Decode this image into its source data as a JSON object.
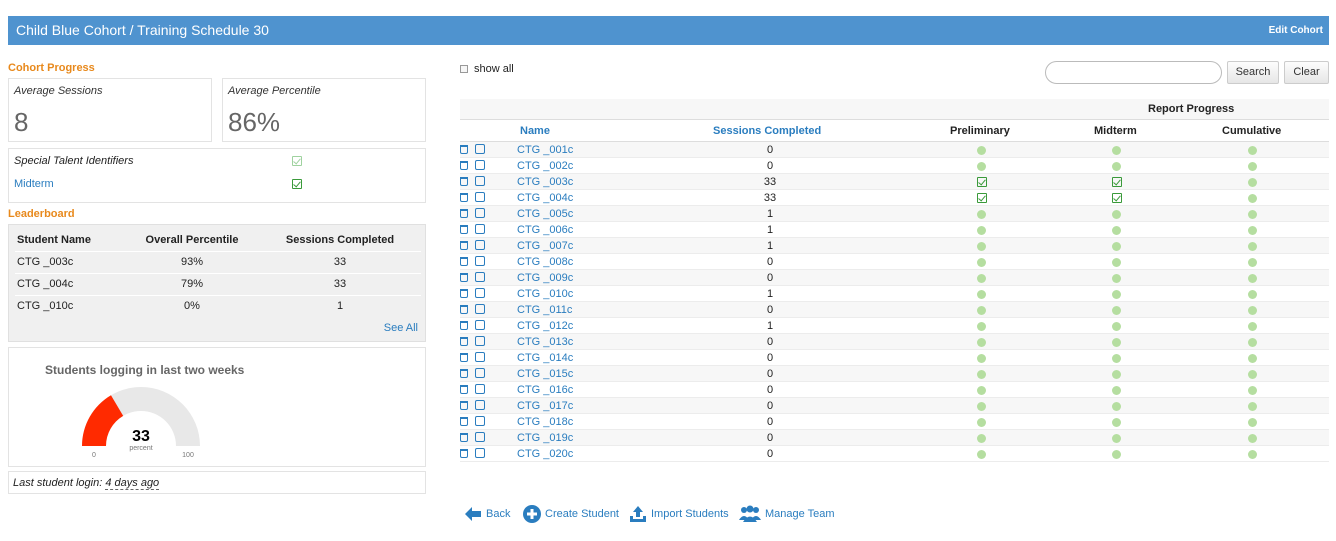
{
  "header": {
    "title": "Child Blue Cohort / Training Schedule 30",
    "edit_label": "Edit Cohort"
  },
  "cohort_progress": {
    "title": "Cohort Progress",
    "avg_sessions_label": "Average Sessions",
    "avg_sessions_value": "8",
    "avg_percentile_label": "Average Percentile",
    "avg_percentile_value": "86%"
  },
  "talent": {
    "label": "Special Talent Identifiers",
    "midterm_label": "Midterm"
  },
  "leaderboard": {
    "title": "Leaderboard",
    "headers": [
      "Student Name",
      "Overall Percentile",
      "Sessions Completed"
    ],
    "rows": [
      [
        "CTG _003c",
        "93%",
        "33"
      ],
      [
        "CTG _004c",
        "79%",
        "33"
      ],
      [
        "CTG _010c",
        "0%",
        "1"
      ]
    ],
    "see_all": "See All"
  },
  "gauge": {
    "title": "Students logging in last two weeks",
    "value": "33",
    "value_fraction": 0.33,
    "unit": "percent",
    "min": "0",
    "max": "100",
    "fill_color": "#ff2a00",
    "track_color": "#e8e8e8"
  },
  "last_login": {
    "label": "Last student login:",
    "value": "4 days ago"
  },
  "controls": {
    "show_all": "show all",
    "search_placeholder": "",
    "search_label": "Search",
    "clear_label": "Clear"
  },
  "students_table": {
    "report_progress": "Report Progress",
    "headers": {
      "name": "Name",
      "sessions": "Sessions Completed",
      "preliminary": "Preliminary",
      "midterm": "Midterm",
      "cumulative": "Cumulative"
    },
    "rows": [
      {
        "name": "CTG _001c",
        "sessions": "0",
        "prelim": "dot",
        "mid": "dot",
        "cum": "dot"
      },
      {
        "name": "CTG _002c",
        "sessions": "0",
        "prelim": "dot",
        "mid": "dot",
        "cum": "dot"
      },
      {
        "name": "CTG _003c",
        "sessions": "33",
        "prelim": "check",
        "mid": "check",
        "cum": "dot"
      },
      {
        "name": "CTG _004c",
        "sessions": "33",
        "prelim": "check",
        "mid": "check",
        "cum": "dot"
      },
      {
        "name": "CTG _005c",
        "sessions": "1",
        "prelim": "dot",
        "mid": "dot",
        "cum": "dot"
      },
      {
        "name": "CTG _006c",
        "sessions": "1",
        "prelim": "dot",
        "mid": "dot",
        "cum": "dot"
      },
      {
        "name": "CTG _007c",
        "sessions": "1",
        "prelim": "dot",
        "mid": "dot",
        "cum": "dot"
      },
      {
        "name": "CTG _008c",
        "sessions": "0",
        "prelim": "dot",
        "mid": "dot",
        "cum": "dot"
      },
      {
        "name": "CTG _009c",
        "sessions": "0",
        "prelim": "dot",
        "mid": "dot",
        "cum": "dot"
      },
      {
        "name": "CTG _010c",
        "sessions": "1",
        "prelim": "dot",
        "mid": "dot",
        "cum": "dot"
      },
      {
        "name": "CTG _011c",
        "sessions": "0",
        "prelim": "dot",
        "mid": "dot",
        "cum": "dot"
      },
      {
        "name": "CTG _012c",
        "sessions": "1",
        "prelim": "dot",
        "mid": "dot",
        "cum": "dot"
      },
      {
        "name": "CTG _013c",
        "sessions": "0",
        "prelim": "dot",
        "mid": "dot",
        "cum": "dot"
      },
      {
        "name": "CTG _014c",
        "sessions": "0",
        "prelim": "dot",
        "mid": "dot",
        "cum": "dot"
      },
      {
        "name": "CTG _015c",
        "sessions": "0",
        "prelim": "dot",
        "mid": "dot",
        "cum": "dot"
      },
      {
        "name": "CTG _016c",
        "sessions": "0",
        "prelim": "dot",
        "mid": "dot",
        "cum": "dot"
      },
      {
        "name": "CTG _017c",
        "sessions": "0",
        "prelim": "dot",
        "mid": "dot",
        "cum": "dot"
      },
      {
        "name": "CTG _018c",
        "sessions": "0",
        "prelim": "dot",
        "mid": "dot",
        "cum": "dot"
      },
      {
        "name": "CTG _019c",
        "sessions": "0",
        "prelim": "dot",
        "mid": "dot",
        "cum": "dot"
      },
      {
        "name": "CTG _020c",
        "sessions": "0",
        "prelim": "dot",
        "mid": "dot",
        "cum": "dot"
      }
    ]
  },
  "bottom_nav": {
    "back": "Back",
    "create_student": "Create Student",
    "import_students": "Import Students",
    "manage_team": "Manage Team"
  },
  "colors": {
    "header": "#4f93cf",
    "accent": "#e8891c",
    "link": "#2a7dbf",
    "status_dot": "#b5dea0"
  }
}
